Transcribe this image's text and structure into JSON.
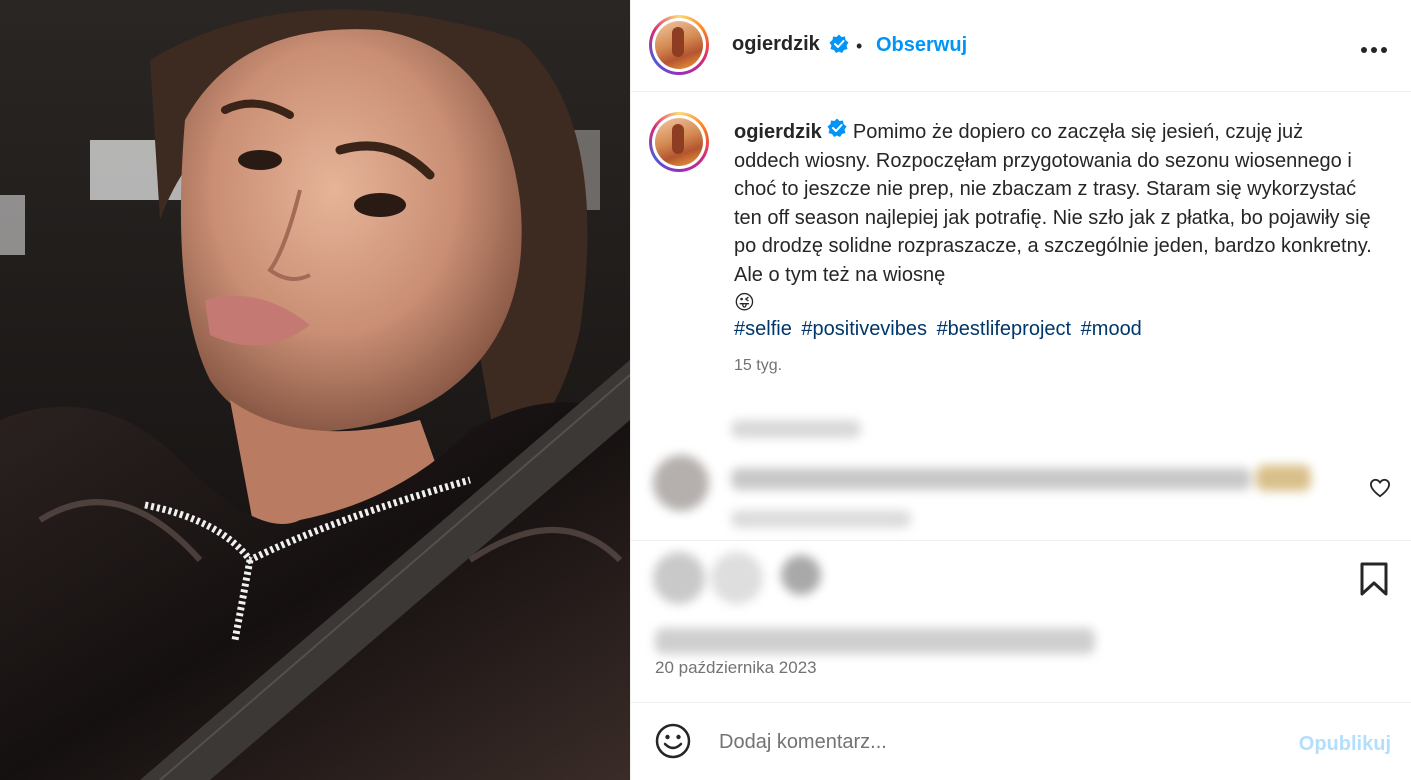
{
  "header": {
    "username": "ogierdzik",
    "separator": "•",
    "follow_label": "Obserwuj",
    "more_label": "•••"
  },
  "caption": {
    "username": "ogierdzik",
    "text": "Pomimo że dopiero co zaczęła się jesień, czuję już oddech wiosny. Rozpoczęłam przygotowania do sezonu wiosennego i choć to jeszcze nie prep, nie zbaczam z trasy. Staram się wykorzystać ten off season najlepiej jak potrafię. Nie szło jak z płatka, bo pojawiły się po drodzę solidne rozpraszacze, a szczególnie jeden, bardzo konkretny. Ale o tym też na wiosnę",
    "emoji": "😜",
    "hashtags": [
      "#selfie",
      "#positivevibes",
      "#bestlifeproject",
      "#mood"
    ],
    "age": "15 tyg."
  },
  "post": {
    "date": "20 października 2023"
  },
  "comment_bar": {
    "placeholder": "Dodaj komentarz...",
    "publish_label": "Opublikuj"
  },
  "colors": {
    "accent": "#0095f6",
    "hashtag": "#00376b",
    "muted": "#737373",
    "verified": "#0095f6",
    "publish_disabled": "#b2dffc"
  },
  "icons": [
    "verified-badge-icon",
    "more-options-icon",
    "heart-icon",
    "bookmark-icon",
    "emoji-icon"
  ]
}
